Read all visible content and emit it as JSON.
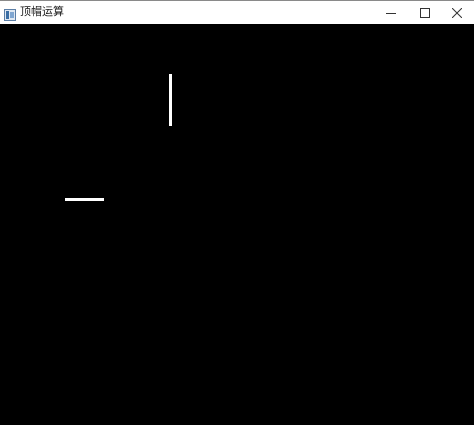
{
  "window": {
    "title": "顶帽运算",
    "app_icon": "window-app-icon"
  },
  "title_buttons": {
    "minimize_icon": "minimize-icon",
    "maximize_icon": "maximize-icon",
    "close_icon": "close-icon"
  },
  "colors": {
    "canvas_background": "#000000",
    "stroke": "#ffffff",
    "titlebar": "#ffffff"
  }
}
